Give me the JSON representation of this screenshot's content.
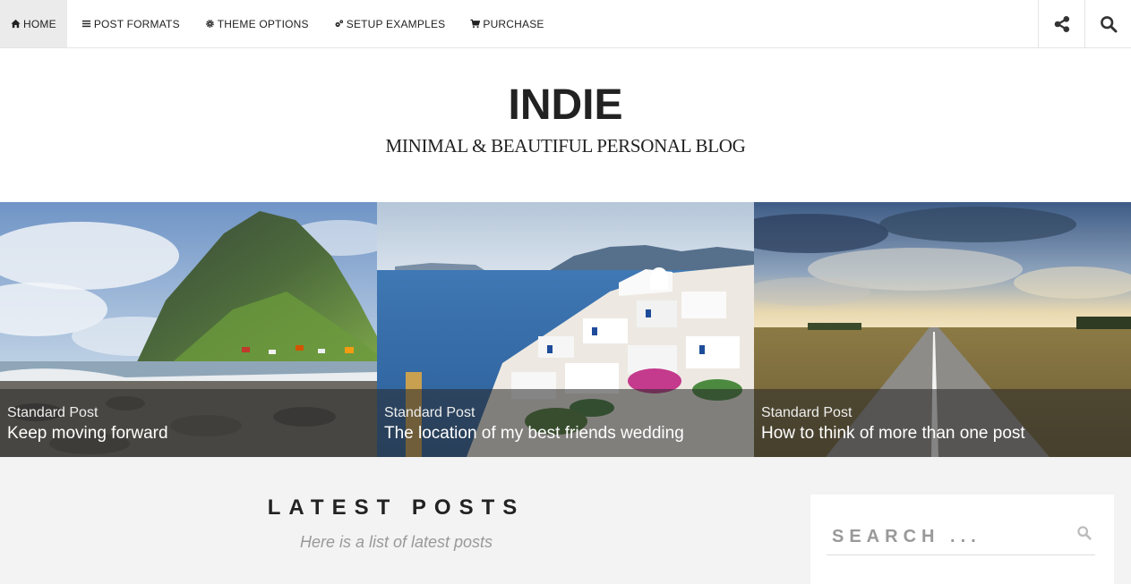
{
  "nav": {
    "items": [
      {
        "label": "HOME",
        "icon": "home-icon",
        "active": true
      },
      {
        "label": "POST FORMATS",
        "icon": "list-icon"
      },
      {
        "label": "THEME OPTIONS",
        "icon": "gear-icon"
      },
      {
        "label": "SETUP EXAMPLES",
        "icon": "gears-icon"
      },
      {
        "label": "PURCHASE",
        "icon": "cart-icon"
      }
    ],
    "right": [
      "share-icon",
      "search-icon"
    ]
  },
  "header": {
    "title": "INDIE",
    "tagline": "MINIMAL & BEAUTIFUL PERSONAL BLOG"
  },
  "slider": [
    {
      "category": "Standard Post",
      "title": "Keep moving forward"
    },
    {
      "category": "Standard Post",
      "title": "The location of my best friends wedding"
    },
    {
      "category": "Standard Post",
      "title": "How to think of more than one post"
    }
  ],
  "main": {
    "section_title": "LATEST POSTS",
    "section_subtitle": "Here is a list of latest posts"
  },
  "search": {
    "placeholder": "SEARCH ..."
  },
  "colors": {
    "nav_active_bg": "#ebebeb",
    "page_bg": "#f3f3f3",
    "text": "#222222",
    "muted": "#999999"
  }
}
